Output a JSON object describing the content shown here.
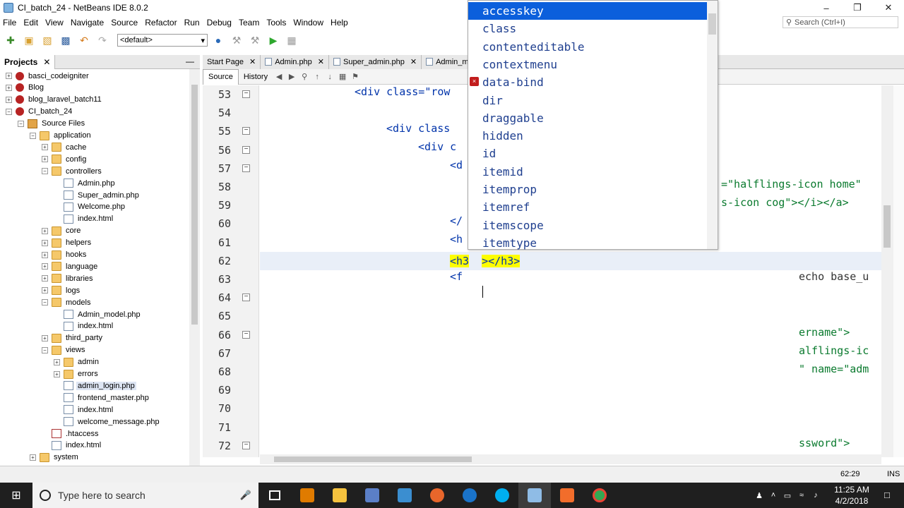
{
  "window": {
    "title": "CI_batch_24 - NetBeans IDE 8.0.2"
  },
  "menubar": [
    "File",
    "Edit",
    "View",
    "Navigate",
    "Source",
    "Refactor",
    "Run",
    "Debug",
    "Team",
    "Tools",
    "Window",
    "Help"
  ],
  "search": {
    "placeholder": "Search (Ctrl+I)"
  },
  "toolbar": {
    "config": "<default>"
  },
  "projects_panel": {
    "title": "Projects",
    "tree": [
      {
        "label": "basci_codeigniter",
        "depth": 0,
        "icon": "project",
        "toggle": "+"
      },
      {
        "label": "Blog",
        "depth": 0,
        "icon": "project",
        "toggle": "+"
      },
      {
        "label": "blog_laravel_batch11",
        "depth": 0,
        "icon": "project",
        "toggle": "+"
      },
      {
        "label": "CI_batch_24",
        "depth": 0,
        "icon": "project",
        "toggle": "-"
      },
      {
        "label": "Source Files",
        "depth": 1,
        "icon": "source",
        "toggle": "-"
      },
      {
        "label": "application",
        "depth": 2,
        "icon": "folder",
        "toggle": "-"
      },
      {
        "label": "cache",
        "depth": 3,
        "icon": "folder",
        "toggle": "+"
      },
      {
        "label": "config",
        "depth": 3,
        "icon": "folder",
        "toggle": "+"
      },
      {
        "label": "controllers",
        "depth": 3,
        "icon": "folder",
        "toggle": "-"
      },
      {
        "label": "Admin.php",
        "depth": 4,
        "icon": "file",
        "toggle": ""
      },
      {
        "label": "Super_admin.php",
        "depth": 4,
        "icon": "file",
        "toggle": ""
      },
      {
        "label": "Welcome.php",
        "depth": 4,
        "icon": "file",
        "toggle": ""
      },
      {
        "label": "index.html",
        "depth": 4,
        "icon": "file",
        "toggle": ""
      },
      {
        "label": "core",
        "depth": 3,
        "icon": "folder",
        "toggle": "+"
      },
      {
        "label": "helpers",
        "depth": 3,
        "icon": "folder",
        "toggle": "+"
      },
      {
        "label": "hooks",
        "depth": 3,
        "icon": "folder",
        "toggle": "+"
      },
      {
        "label": "language",
        "depth": 3,
        "icon": "folder",
        "toggle": "+"
      },
      {
        "label": "libraries",
        "depth": 3,
        "icon": "folder",
        "toggle": "+"
      },
      {
        "label": "logs",
        "depth": 3,
        "icon": "folder",
        "toggle": "+"
      },
      {
        "label": "models",
        "depth": 3,
        "icon": "folder",
        "toggle": "-"
      },
      {
        "label": "Admin_model.php",
        "depth": 4,
        "icon": "file",
        "toggle": ""
      },
      {
        "label": "index.html",
        "depth": 4,
        "icon": "file",
        "toggle": ""
      },
      {
        "label": "third_party",
        "depth": 3,
        "icon": "folder",
        "toggle": "+"
      },
      {
        "label": "views",
        "depth": 3,
        "icon": "folder",
        "toggle": "-"
      },
      {
        "label": "admin",
        "depth": 4,
        "icon": "folder",
        "toggle": "+"
      },
      {
        "label": "errors",
        "depth": 4,
        "icon": "folder",
        "toggle": "+"
      },
      {
        "label": "admin_login.php",
        "depth": 4,
        "icon": "file",
        "toggle": "",
        "selected": true
      },
      {
        "label": "frontend_master.php",
        "depth": 4,
        "icon": "file",
        "toggle": ""
      },
      {
        "label": "index.html",
        "depth": 4,
        "icon": "file",
        "toggle": ""
      },
      {
        "label": "welcome_message.php",
        "depth": 4,
        "icon": "file",
        "toggle": ""
      },
      {
        "label": ".htaccess",
        "depth": 3,
        "icon": "htaccess",
        "toggle": ""
      },
      {
        "label": "index.html",
        "depth": 3,
        "icon": "file",
        "toggle": ""
      },
      {
        "label": "system",
        "depth": 2,
        "icon": "folder",
        "toggle": "+"
      }
    ]
  },
  "editor_tabs": [
    {
      "label": "Start Page"
    },
    {
      "label": "Admin.php"
    },
    {
      "label": "Super_admin.php"
    },
    {
      "label": "Admin_mode"
    }
  ],
  "editor_subtabs": {
    "source": "Source",
    "history": "History"
  },
  "line_numbers": [
    "53",
    "54",
    "55",
    "56",
    "57",
    "58",
    "59",
    "60",
    "61",
    "62",
    "63",
    "64",
    "65",
    "66",
    "67",
    "68",
    "69",
    "70",
    "71",
    "72"
  ],
  "code_fragments": {
    "l53": "<div class=\"row",
    "l55": "<div class",
    "l56": "<div c",
    "l57": "<d",
    "l58": "=\"halflings-icon home\"",
    "l59": "s-icon cog\"></i></a>",
    "l60": "</",
    "l61": "<h",
    "l62_open": "<h3",
    "l62_close": "></h3>",
    "l63a": "<f",
    "l63b": "echo base_u",
    "l66": "ername\">",
    "l67": "alflings-ic",
    "l68": "\" name=\"adm",
    "l72": "ssword\">"
  },
  "completion": {
    "items": [
      "accesskey",
      "class",
      "contenteditable",
      "contextmenu",
      "data-bind",
      "dir",
      "draggable",
      "hidden",
      "id",
      "itemid",
      "itemprop",
      "itemref",
      "itemscope",
      "itemtype"
    ],
    "selected_index": 0
  },
  "statusbar": {
    "position": "62:29",
    "mode": "INS"
  },
  "taskbar": {
    "search_placeholder": "Type here to search",
    "time": "11:25 AM",
    "date": "4/2/2018"
  }
}
